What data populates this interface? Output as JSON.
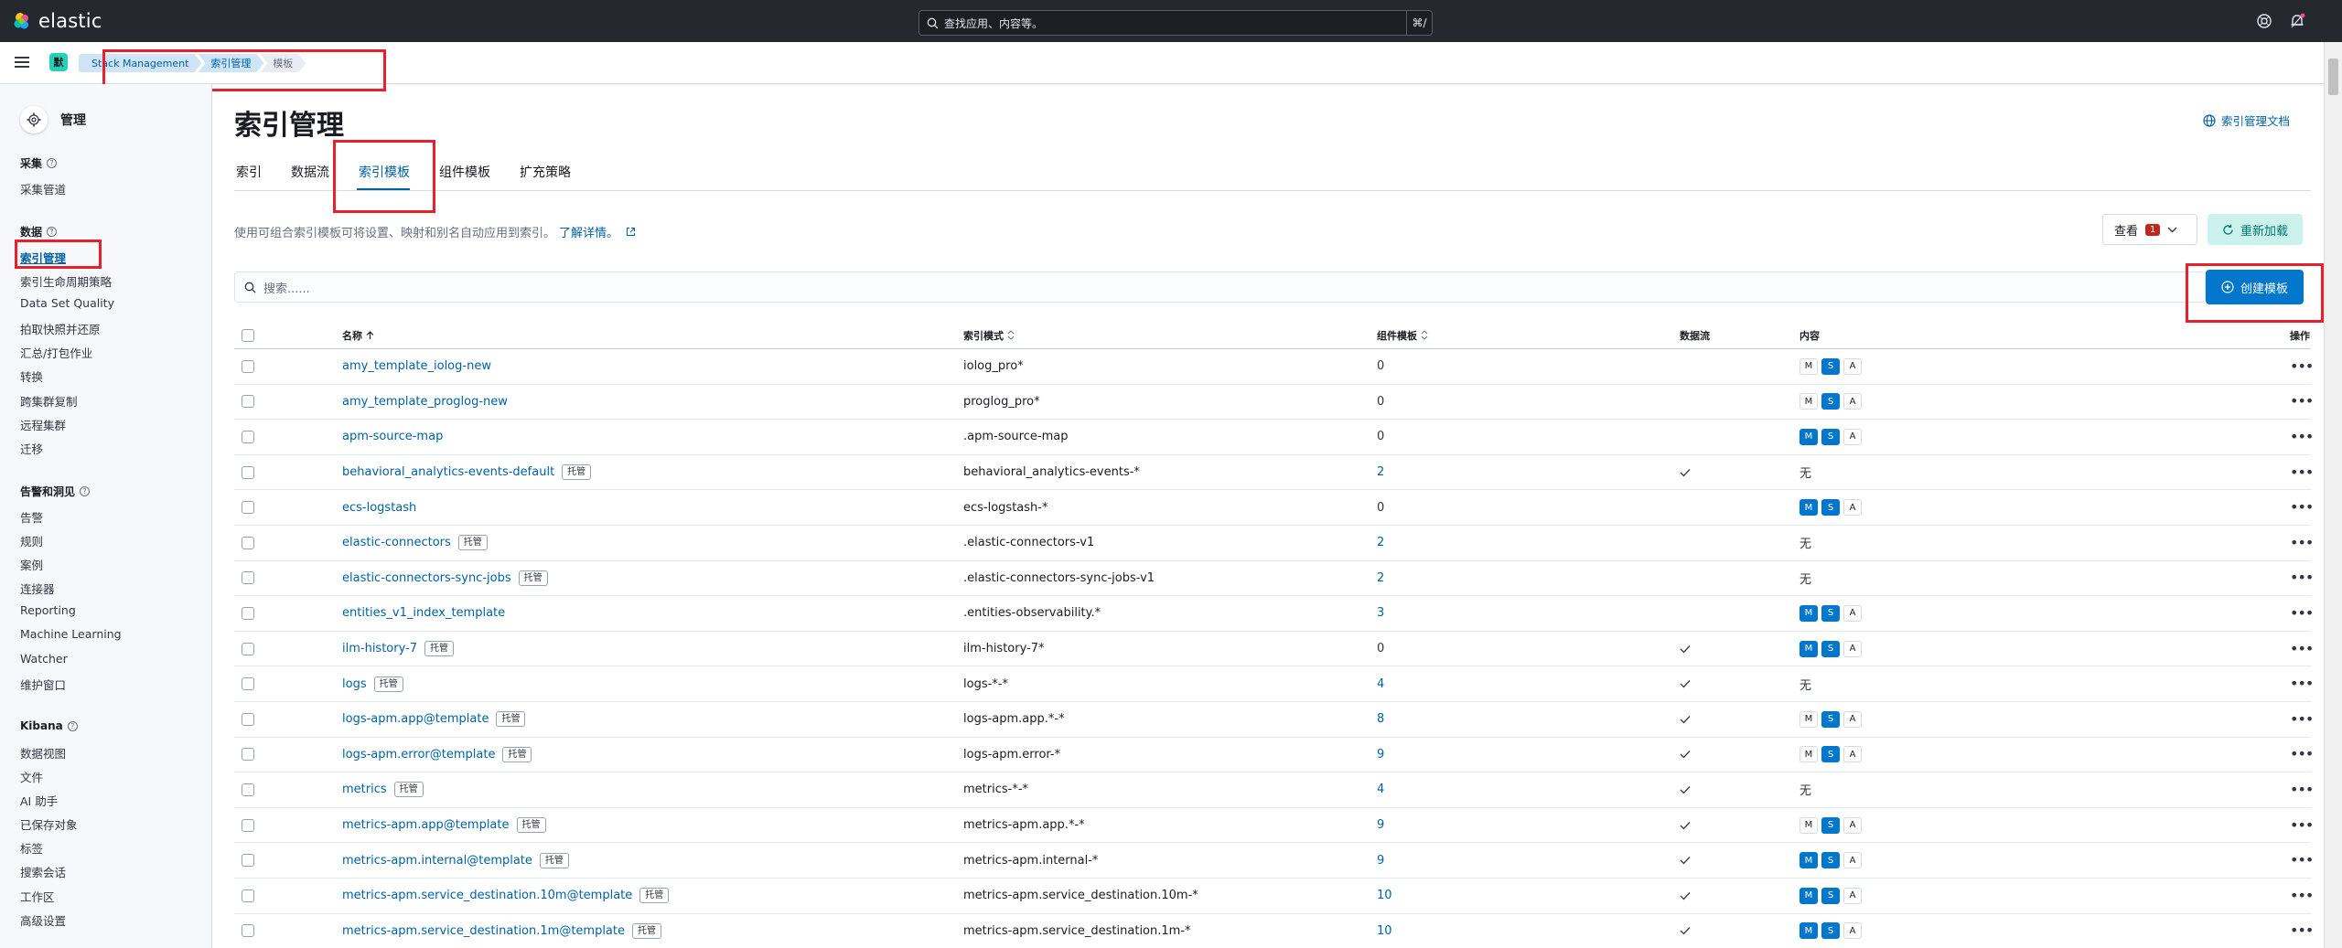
{
  "brand": {
    "name": "elastic"
  },
  "top_search": {
    "placeholder": "查找应用、内容等。",
    "shortcut": "⌘/"
  },
  "space": {
    "initial": "默"
  },
  "breadcrumbs": [
    "Stack Management",
    "索引管理",
    "模板"
  ],
  "sidebar": {
    "title": "管理",
    "groups": [
      {
        "label": "采集",
        "items": [
          "采集管道"
        ]
      },
      {
        "label": "数据",
        "items": [
          "索引管理",
          "索引生命周期策略",
          "Data Set Quality",
          "拍取快照并还原",
          "汇总/打包作业",
          "转换",
          "跨集群复制",
          "远程集群",
          "迁移"
        ]
      },
      {
        "label": "告警和洞见",
        "items": [
          "告警",
          "规则",
          "案例",
          "连接器",
          "Reporting",
          "Machine Learning",
          "Watcher",
          "维护窗口"
        ]
      },
      {
        "label": "Kibana",
        "items": [
          "数据视图",
          "文件",
          "AI 助手",
          "已保存对象",
          "标签",
          "搜索会话",
          "工作区",
          "高级设置"
        ]
      }
    ],
    "active_item": "索引管理"
  },
  "page": {
    "title": "索引管理",
    "docs_link": "索引管理文档",
    "tabs": [
      "索引",
      "数据流",
      "索引模板",
      "组件模板",
      "扩充策略"
    ],
    "active_tab": "索引模板",
    "description": "使用可组合索引模板可将设置、映射和别名自动应用到索引。",
    "learn_more": "了解详情。",
    "view_label": "查看",
    "view_badge": "1",
    "reload_label": "重新加载",
    "search_placeholder": "搜索......",
    "create_label": "创建模板"
  },
  "table": {
    "columns": {
      "name": "名称",
      "pattern": "索引模式",
      "components": "组件模板",
      "datastream": "数据流",
      "content": "内容",
      "actions": "操作"
    },
    "managed_label": "托管",
    "none_label": "无",
    "rows": [
      {
        "name": "amy_template_iolog-new",
        "managed": false,
        "pattern": "iolog_pro*",
        "components": "0",
        "datastream": false,
        "content": {
          "M": false,
          "S": true,
          "A": false
        }
      },
      {
        "name": "amy_template_proglog-new",
        "managed": false,
        "pattern": "proglog_pro*",
        "components": "0",
        "datastream": false,
        "content": {
          "M": false,
          "S": true,
          "A": false
        }
      },
      {
        "name": "apm-source-map",
        "managed": false,
        "pattern": ".apm-source-map",
        "components": "0",
        "datastream": false,
        "content": {
          "M": true,
          "S": true,
          "A": false
        }
      },
      {
        "name": "behavioral_analytics-events-default",
        "managed": true,
        "pattern": "behavioral_analytics-events-*",
        "components": "2",
        "datastream": true,
        "content": null
      },
      {
        "name": "ecs-logstash",
        "managed": false,
        "pattern": "ecs-logstash-*",
        "components": "0",
        "datastream": false,
        "content": {
          "M": true,
          "S": true,
          "A": false
        }
      },
      {
        "name": "elastic-connectors",
        "managed": true,
        "pattern": ".elastic-connectors-v1",
        "components": "2",
        "datastream": false,
        "content": null
      },
      {
        "name": "elastic-connectors-sync-jobs",
        "managed": true,
        "pattern": ".elastic-connectors-sync-jobs-v1",
        "components": "2",
        "datastream": false,
        "content": null
      },
      {
        "name": "entities_v1_index_template",
        "managed": false,
        "pattern": ".entities-observability.*",
        "components": "3",
        "datastream": false,
        "content": {
          "M": true,
          "S": true,
          "A": false
        }
      },
      {
        "name": "ilm-history-7",
        "managed": true,
        "pattern": "ilm-history-7*",
        "components": "0",
        "datastream": true,
        "content": {
          "M": true,
          "S": true,
          "A": false
        }
      },
      {
        "name": "logs",
        "managed": true,
        "pattern": "logs-*-*",
        "components": "4",
        "datastream": true,
        "content": null
      },
      {
        "name": "logs-apm.app@template",
        "managed": true,
        "pattern": "logs-apm.app.*-*",
        "components": "8",
        "datastream": true,
        "content": {
          "M": false,
          "S": true,
          "A": false
        }
      },
      {
        "name": "logs-apm.error@template",
        "managed": true,
        "pattern": "logs-apm.error-*",
        "components": "9",
        "datastream": true,
        "content": {
          "M": false,
          "S": true,
          "A": false
        }
      },
      {
        "name": "metrics",
        "managed": true,
        "pattern": "metrics-*-*",
        "components": "4",
        "datastream": true,
        "content": null
      },
      {
        "name": "metrics-apm.app@template",
        "managed": true,
        "pattern": "metrics-apm.app.*-*",
        "components": "9",
        "datastream": true,
        "content": {
          "M": false,
          "S": true,
          "A": false
        }
      },
      {
        "name": "metrics-apm.internal@template",
        "managed": true,
        "pattern": "metrics-apm.internal-*",
        "components": "9",
        "datastream": true,
        "content": {
          "M": true,
          "S": true,
          "A": false
        }
      },
      {
        "name": "metrics-apm.service_destination.10m@template",
        "managed": true,
        "pattern": "metrics-apm.service_destination.10m-*",
        "components": "10",
        "datastream": true,
        "content": {
          "M": true,
          "S": true,
          "A": false
        }
      },
      {
        "name": "metrics-apm.service_destination.1m@template",
        "managed": true,
        "pattern": "metrics-apm.service_destination.1m-*",
        "components": "10",
        "datastream": true,
        "content": {
          "M": true,
          "S": true,
          "A": false
        }
      }
    ]
  },
  "colors": {
    "primary": "#0077cc",
    "link": "#0061a6",
    "highlight_box": "#e7202b",
    "topbar": "#25282f"
  }
}
